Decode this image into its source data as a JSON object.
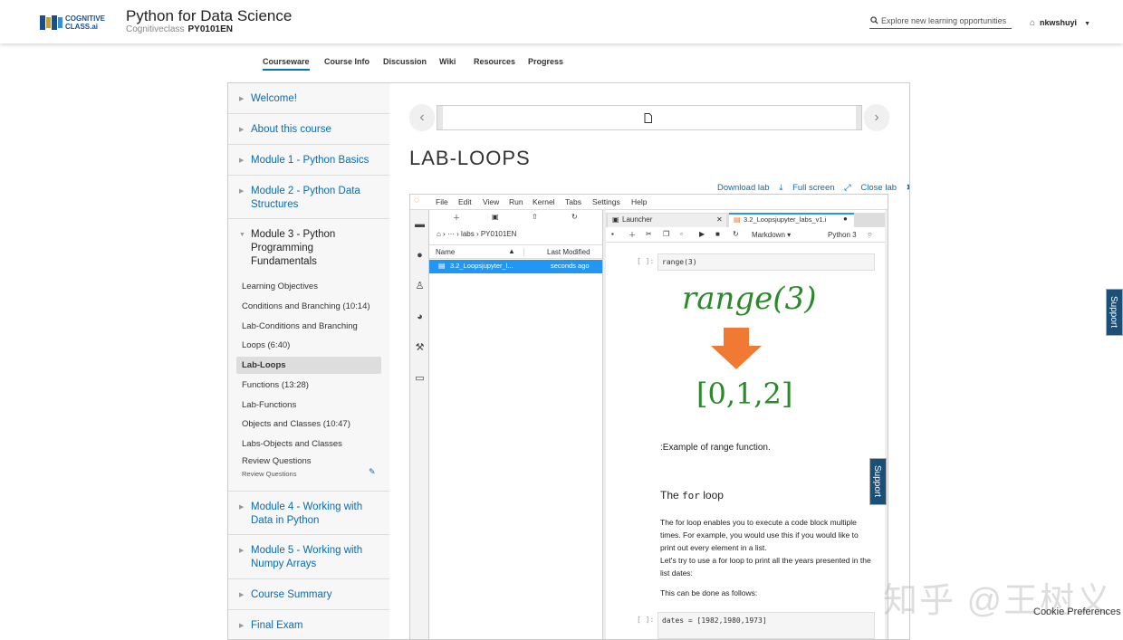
{
  "header": {
    "logo_text": "COGNITIVE CLASS.ai",
    "course_title": "Python for Data Science",
    "provider": "Cognitiveclass",
    "course_code": "PY0101EN",
    "search_placeholder": "Explore new learning opportunities",
    "username": "nkwshuyi"
  },
  "tabs": [
    "Courseware",
    "Course Info",
    "Discussion",
    "Wiki",
    "Resources",
    "Progress"
  ],
  "outline": {
    "sections": [
      {
        "label": "Welcome!"
      },
      {
        "label": "About this course"
      },
      {
        "label": "Module 1 - Python Basics"
      },
      {
        "label": "Module 2 - Python Data Structures"
      },
      {
        "label": "Module 3 - Python Programming Fundamentals"
      },
      {
        "label": "Module 4 - Working with Data in Python"
      },
      {
        "label": "Module 5 - Working with Numpy Arrays"
      },
      {
        "label": "Course Summary"
      },
      {
        "label": "Final Exam"
      }
    ],
    "subsections": [
      "Learning Objectives",
      "Conditions and Branching (10:14)",
      "Lab-Conditions and Branching",
      "Loops (6:40)",
      "Lab-Loops",
      "Functions (13:28)",
      "Lab-Functions",
      "Objects and Classes (10:47)",
      "Labs-Objects and Classes",
      "Review Questions"
    ],
    "review_sub": "Review Questions"
  },
  "content": {
    "unit_title": "LAB-LOOPS",
    "links": [
      "Download lab",
      "Full screen",
      "Close lab"
    ]
  },
  "jupyter": {
    "menu": [
      "File",
      "Edit",
      "View",
      "Run",
      "Kernel",
      "Tabs",
      "Settings",
      "Help"
    ],
    "breadcrumb": "labs › PY0101EN",
    "file_headers": [
      "Name",
      "Last Modified"
    ],
    "file_row": {
      "name": "3.2_Loopsjupyter_l...",
      "modified": "seconds ago"
    },
    "tabs": [
      "Launcher",
      "3.2_Loopsjupyter_labs_v1.i"
    ],
    "cell_type": "Markdown",
    "kernel": "Python 3",
    "prompt": "[ ]:",
    "code1": "range(3)",
    "big_range": "range(3)",
    "big_list": "[0,1,2]",
    "caption": ":Example of range function.",
    "heading_pre": "The",
    "heading_code": "for",
    "heading_post": "loop",
    "para1": "The for loop enables you to execute a code block multiple times. For example, you would use this if you would like to print out every element in a list.",
    "para2": "Let's try to use a for loop to print all the years presented in the list dates:",
    "para3": "This can be done as follows:",
    "code2": "dates = [1982,1980,1973]"
  },
  "support_label": "Support",
  "cookie": "Cookie Preferences",
  "watermark": "知乎 @王树义",
  "colors": {
    "link": "#0b6bb0",
    "accent": "#0075b4",
    "orange": "#f07a33",
    "green": "#2a8a2a"
  }
}
